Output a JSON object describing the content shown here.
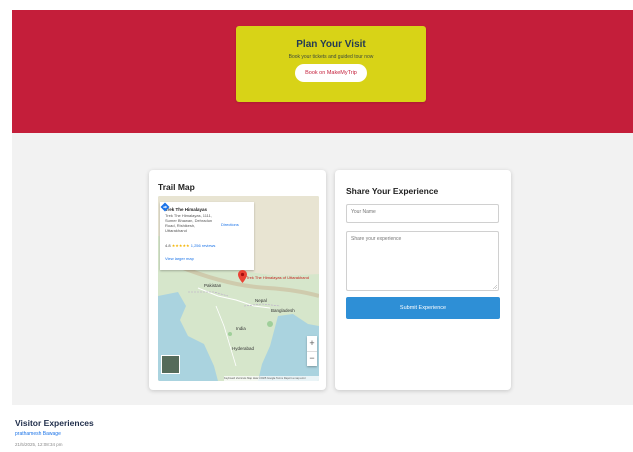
{
  "plan": {
    "title": "Plan Your Visit",
    "subtitle": "Book your tickets and guided tour now",
    "book_button": "Book on MakeMyTrip"
  },
  "trail_map": {
    "title": "Trail Map",
    "info": {
      "place": "Trek The Himalayas",
      "address": "Trek The Himalayas, 1111, Sumer Bhawan, Dehradun Road, Rishikesh, Uttarakhand",
      "rating": "4.8",
      "stars": "★★★★★",
      "reviews": "1,256 reviews",
      "larger_map": "View larger map",
      "directions": "Directions"
    },
    "pin_label": "Trek The Himalayas\nof Uttarakhand",
    "labels": {
      "pakistan": "Pakistan",
      "nepal": "Nepal",
      "india": "India",
      "bangladesh": "Bangladesh",
      "hyderabad": "Hyderabad"
    },
    "attribution": "Keyboard shortcuts  Map data ©2025 Google  Terms  Report a map error",
    "zoom_in": "+",
    "zoom_out": "−"
  },
  "share": {
    "title": "Share Your Experience",
    "name_placeholder": "Your Name",
    "experience_placeholder": "Share your experience",
    "submit_button": "Submit Experience"
  },
  "visitors": {
    "title": "Visitor Experiences",
    "entries": [
      {
        "name": "prathamesh Bawage",
        "date": "21/5/2025, 12:08:34 pm"
      }
    ]
  },
  "colors": {
    "banner": "#c41e3a",
    "plan_card": "#d8d317",
    "submit": "#2e8fd6",
    "section_bg": "#f2f2f2"
  },
  "icons": {
    "map_pin": "map-pin-icon",
    "directions": "directions-icon",
    "resize": "resize-handle-icon"
  }
}
